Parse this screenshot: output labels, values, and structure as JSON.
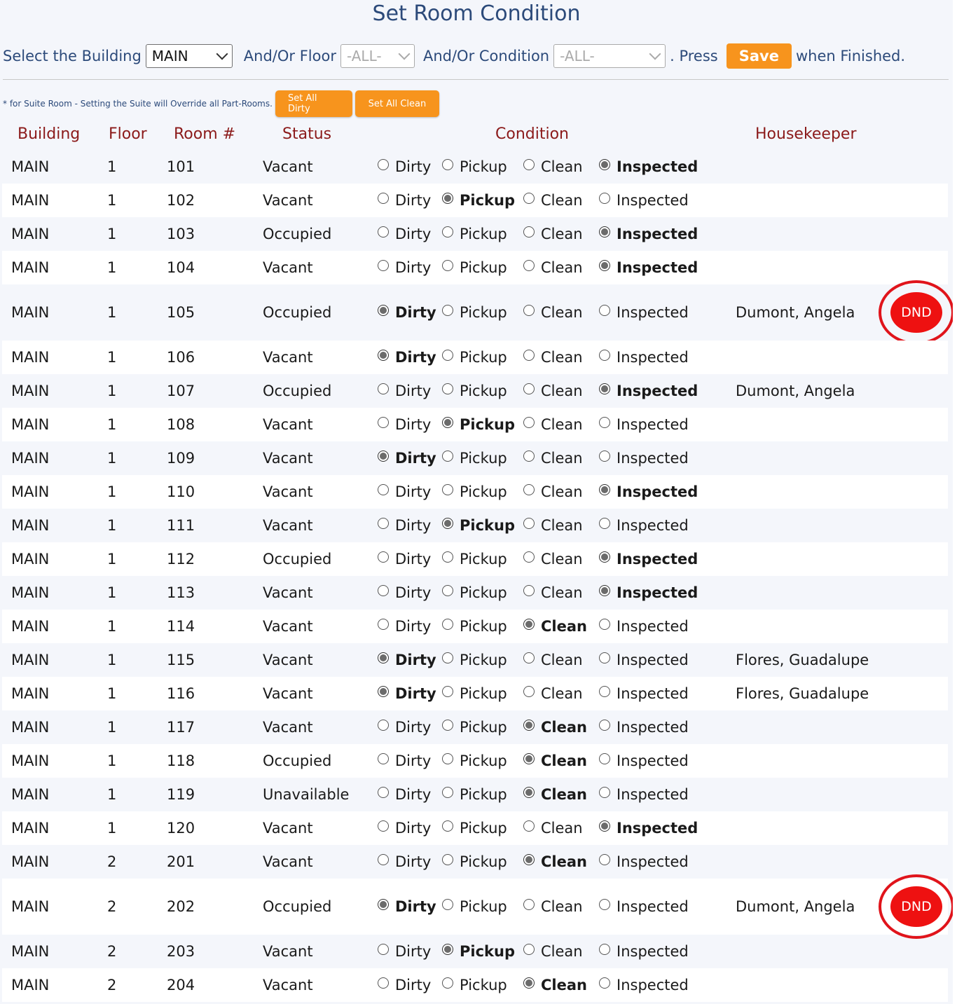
{
  "title": "Set Room Condition",
  "filters": {
    "building_label": "Select the Building",
    "building_value": "MAIN",
    "floor_label": "And/Or Floor",
    "floor_value": "-ALL-",
    "condition_label": "And/Or Condition",
    "condition_value": "-ALL-",
    "press_label": ". Press",
    "save_label": "Save",
    "finished_label": "when Finished."
  },
  "note": "* for Suite Room - Setting the Suite will Override all Part-Rooms.",
  "bulk": {
    "set_all_dirty": "Set All Dirty",
    "set_all_clean": "Set All Clean"
  },
  "columns": {
    "building": "Building",
    "floor": "Floor",
    "room": "Room #",
    "status": "Status",
    "condition": "Condition",
    "housekeeper": "Housekeeper"
  },
  "condition_options": [
    "Dirty",
    "Pickup",
    "Clean",
    "Inspected"
  ],
  "dnd_label": "DND",
  "colors": {
    "accent": "#f7941d",
    "header_red": "#8b1a1a",
    "title_blue": "#2c4a7a",
    "dnd_red": "#ee1111"
  },
  "rows": [
    {
      "building": "MAIN",
      "floor": "1",
      "room": "101",
      "status": "Vacant",
      "condition": "Inspected",
      "housekeeper": "",
      "dnd": false
    },
    {
      "building": "MAIN",
      "floor": "1",
      "room": "102",
      "status": "Vacant",
      "condition": "Pickup",
      "housekeeper": "",
      "dnd": false
    },
    {
      "building": "MAIN",
      "floor": "1",
      "room": "103",
      "status": "Occupied",
      "condition": "Inspected",
      "housekeeper": "",
      "dnd": false
    },
    {
      "building": "MAIN",
      "floor": "1",
      "room": "104",
      "status": "Vacant",
      "condition": "Inspected",
      "housekeeper": "",
      "dnd": false
    },
    {
      "building": "MAIN",
      "floor": "1",
      "room": "105",
      "status": "Occupied",
      "condition": "Dirty",
      "housekeeper": "Dumont, Angela",
      "dnd": true
    },
    {
      "building": "MAIN",
      "floor": "1",
      "room": "106",
      "status": "Vacant",
      "condition": "Dirty",
      "housekeeper": "",
      "dnd": false
    },
    {
      "building": "MAIN",
      "floor": "1",
      "room": "107",
      "status": "Occupied",
      "condition": "Inspected",
      "housekeeper": "Dumont, Angela",
      "dnd": false
    },
    {
      "building": "MAIN",
      "floor": "1",
      "room": "108",
      "status": "Vacant",
      "condition": "Pickup",
      "housekeeper": "",
      "dnd": false
    },
    {
      "building": "MAIN",
      "floor": "1",
      "room": "109",
      "status": "Vacant",
      "condition": "Dirty",
      "housekeeper": "",
      "dnd": false
    },
    {
      "building": "MAIN",
      "floor": "1",
      "room": "110",
      "status": "Vacant",
      "condition": "Inspected",
      "housekeeper": "",
      "dnd": false
    },
    {
      "building": "MAIN",
      "floor": "1",
      "room": "111",
      "status": "Vacant",
      "condition": "Pickup",
      "housekeeper": "",
      "dnd": false
    },
    {
      "building": "MAIN",
      "floor": "1",
      "room": "112",
      "status": "Occupied",
      "condition": "Inspected",
      "housekeeper": "",
      "dnd": false
    },
    {
      "building": "MAIN",
      "floor": "1",
      "room": "113",
      "status": "Vacant",
      "condition": "Inspected",
      "housekeeper": "",
      "dnd": false
    },
    {
      "building": "MAIN",
      "floor": "1",
      "room": "114",
      "status": "Vacant",
      "condition": "Clean",
      "housekeeper": "",
      "dnd": false
    },
    {
      "building": "MAIN",
      "floor": "1",
      "room": "115",
      "status": "Vacant",
      "condition": "Dirty",
      "housekeeper": "Flores, Guadalupe",
      "dnd": false
    },
    {
      "building": "MAIN",
      "floor": "1",
      "room": "116",
      "status": "Vacant",
      "condition": "Dirty",
      "housekeeper": "Flores, Guadalupe",
      "dnd": false
    },
    {
      "building": "MAIN",
      "floor": "1",
      "room": "117",
      "status": "Vacant",
      "condition": "Clean",
      "housekeeper": "",
      "dnd": false
    },
    {
      "building": "MAIN",
      "floor": "1",
      "room": "118",
      "status": "Occupied",
      "condition": "Clean",
      "housekeeper": "",
      "dnd": false
    },
    {
      "building": "MAIN",
      "floor": "1",
      "room": "119",
      "status": "Unavailable",
      "condition": "Clean",
      "housekeeper": "",
      "dnd": false
    },
    {
      "building": "MAIN",
      "floor": "1",
      "room": "120",
      "status": "Vacant",
      "condition": "Inspected",
      "housekeeper": "",
      "dnd": false
    },
    {
      "building": "MAIN",
      "floor": "2",
      "room": "201",
      "status": "Vacant",
      "condition": "Clean",
      "housekeeper": "",
      "dnd": false
    },
    {
      "building": "MAIN",
      "floor": "2",
      "room": "202",
      "status": "Occupied",
      "condition": "Dirty",
      "housekeeper": "Dumont, Angela",
      "dnd": true
    },
    {
      "building": "MAIN",
      "floor": "2",
      "room": "203",
      "status": "Vacant",
      "condition": "Pickup",
      "housekeeper": "",
      "dnd": false
    },
    {
      "building": "MAIN",
      "floor": "2",
      "room": "204",
      "status": "Vacant",
      "condition": "Clean",
      "housekeeper": "",
      "dnd": false
    }
  ]
}
